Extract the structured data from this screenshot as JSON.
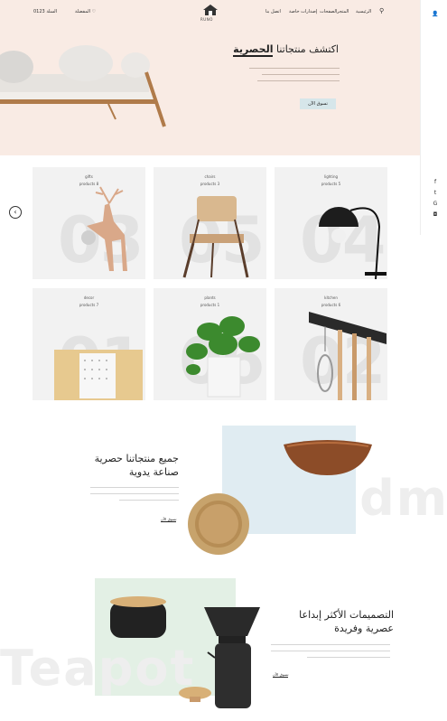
{
  "header": {
    "logo_text": "RUNO",
    "phone": "0123 السلة",
    "wishlist": "المفضلة",
    "nav": [
      "الرئيسية",
      "المتجر",
      "الصفحات",
      "إصدارات خاصة",
      "اتصل بنا"
    ]
  },
  "hero": {
    "title_plain": "اكتشف منتجاتنا",
    "title_bold": "الحصرية",
    "button": "تسوق الآن"
  },
  "products": [
    {
      "cat": "gifts",
      "name": "products 8",
      "num": "03"
    },
    {
      "cat": "chairs",
      "name": "products 3",
      "num": "05"
    },
    {
      "cat": "lighting",
      "name": "products 5",
      "num": "04"
    },
    {
      "cat": "decor",
      "name": "products 7",
      "num": "01"
    },
    {
      "cat": "plants",
      "name": "products 1",
      "num": "06"
    },
    {
      "cat": "kitchen",
      "name": "products 6",
      "num": "02"
    }
  ],
  "section1": {
    "title_line1": "جميع منتجاتنا حصرية",
    "title_line2": "صناعة يدوية",
    "link": "تسوق الآن",
    "watermark": "Handm"
  },
  "section2": {
    "title_line1": "التصميمات الأكثر إبداعا",
    "title_line2": "عصرية وفريدة",
    "link": "تسوق الآن",
    "watermark": "Teapot"
  },
  "sidebar_icons": [
    "user-icon",
    "facebook-icon",
    "twitter-icon",
    "google-icon",
    "instagram-icon"
  ]
}
